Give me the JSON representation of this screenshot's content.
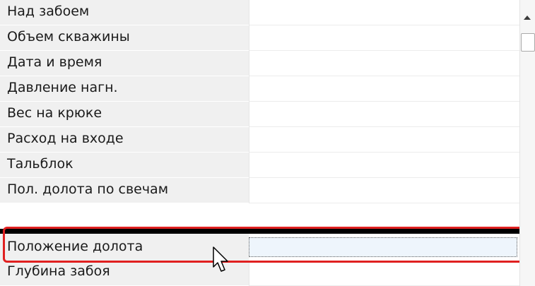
{
  "properties": [
    {
      "label": "Над забоем",
      "value": ""
    },
    {
      "label": "Объем скважины",
      "value": ""
    },
    {
      "label": "Дата и время",
      "value": ""
    },
    {
      "label": "Давление нагн.",
      "value": ""
    },
    {
      "label": "Вес на крюке",
      "value": ""
    },
    {
      "label": "Расход на входе",
      "value": ""
    },
    {
      "label": "Тальблок",
      "value": ""
    },
    {
      "label": "Пол. долота по свечам",
      "value": ""
    }
  ],
  "selected": {
    "label": "Положение долота",
    "value": ""
  },
  "after": {
    "label": "Глубина забоя",
    "value": ""
  },
  "colors": {
    "highlight": "#e02020",
    "label_bg": "#f0f0f0",
    "selected_value_bg": "#eef5fc"
  },
  "icons": {
    "scroll_up": "triangle-up-icon",
    "cursor": "mouse-pointer-icon"
  }
}
